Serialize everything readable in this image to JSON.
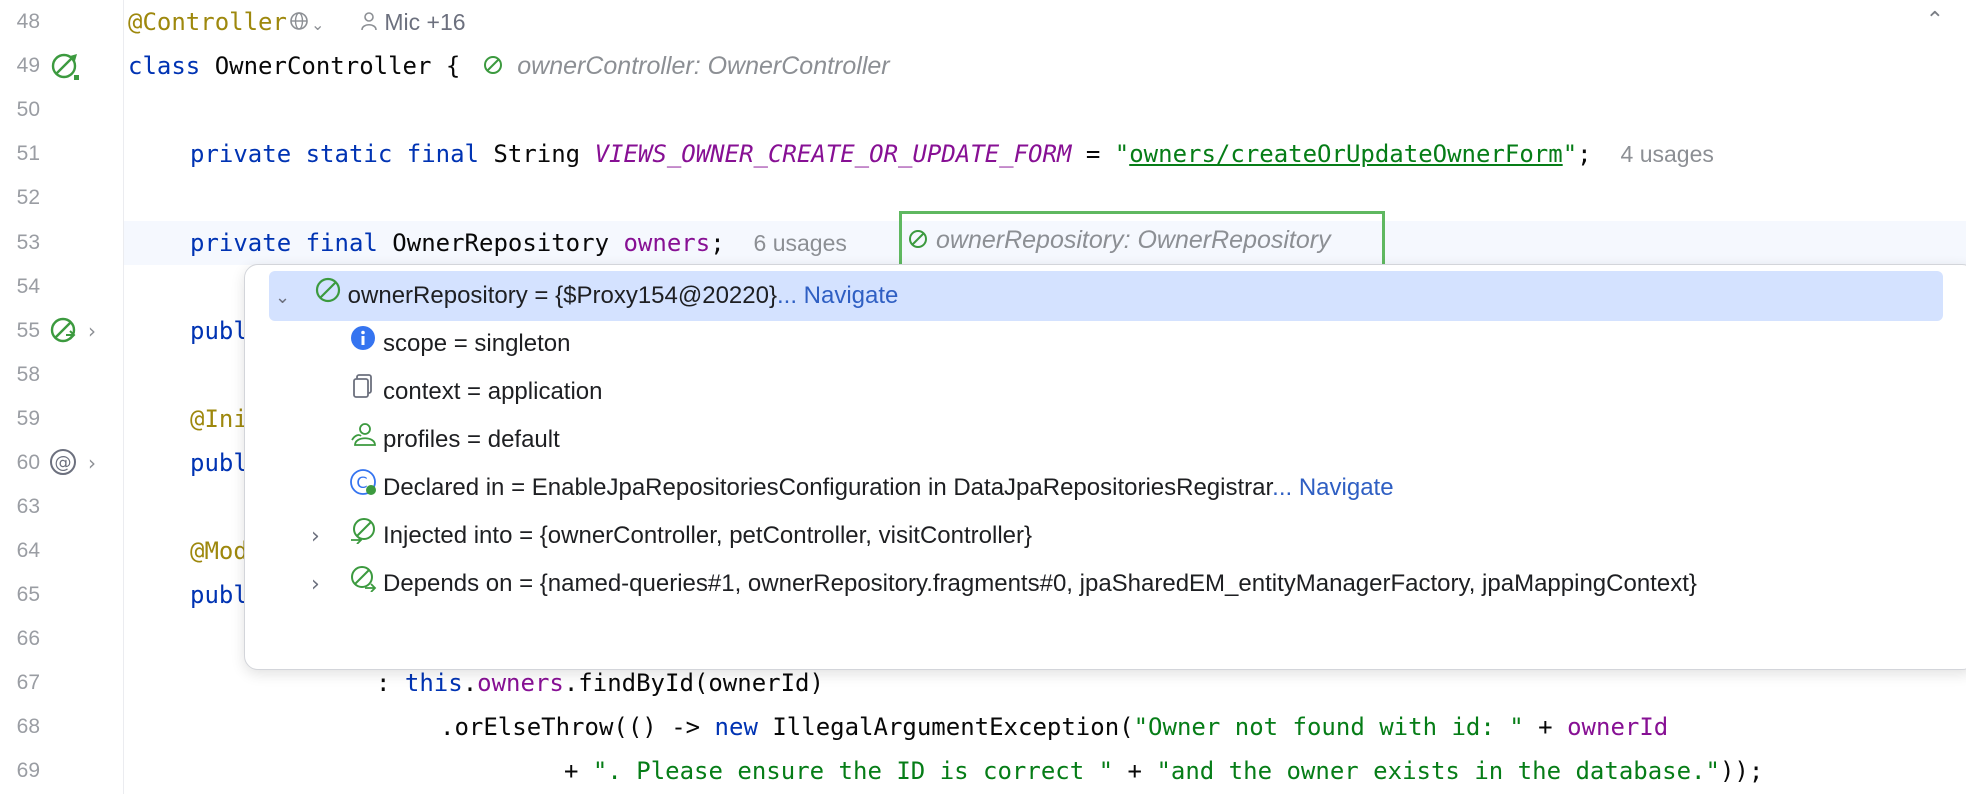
{
  "gutter": {
    "line_numbers": [
      "48",
      "49",
      "50",
      "51",
      "52",
      "53",
      "54",
      "55",
      "58",
      "59",
      "60",
      "63",
      "64",
      "65",
      "66",
      "67",
      "68",
      "69"
    ]
  },
  "code": {
    "l48_annotation": "@Controller",
    "l48_author": "Mic +16",
    "l49_kw": "class",
    "l49_name": " OwnerController {",
    "l49_hint": "ownerController: OwnerController",
    "l51_kw": "private static final",
    "l51_type": " String ",
    "l51_const": "VIEWS_OWNER_CREATE_OR_UPDATE_FORM",
    "l51_eq": " = ",
    "l51_q1": "\"",
    "l51_str": "owners/createOrUpdateOwnerForm",
    "l51_q2": "\"",
    "l51_semi": ";",
    "l51_usages": "4 usages",
    "l53_kw": "private final",
    "l53_type": " OwnerRepository ",
    "l53_field": "owners",
    "l53_semi": ";",
    "l53_usages": "6 usages",
    "l53_hint": "ownerRepository: OwnerRepository",
    "l55_kw": "publ",
    "l59_ann": "@Ini",
    "l60_kw": "publ",
    "l64_ann": "@Mod",
    "l65_kw": "publ",
    "l67_pre": ": ",
    "l67_this": "this",
    "l67_dot": ".",
    "l67_field": "owners",
    "l67_rest": ".findById(ownerId)",
    "l68_pre": ".orElseThrow(() -> ",
    "l68_new": "new",
    "l68_mid": " IllegalArgumentException(",
    "l68_str": "\"Owner not found with id: \"",
    "l68_plus": " + ",
    "l68_var": "ownerId",
    "l69_plus": "+ ",
    "l69_str1": "\". Please ensure the ID is correct \"",
    "l69_plus2": " + ",
    "l69_str2": "\"and the owner exists in the database.\"",
    "l69_end": "));"
  },
  "popup": {
    "root_label": "ownerRepository = {$Proxy154@20220}",
    "root_nav": "... Navigate",
    "scope": "scope = singleton",
    "context": "context = application",
    "profiles": "profiles = default",
    "declared": "Declared in = EnableJpaRepositoriesConfiguration in DataJpaRepositoriesRegistrar",
    "declared_nav": "... Navigate",
    "injected": "Injected into = {ownerController, petController, visitController}",
    "depends": "Depends on = {named-queries#1, ownerRepository.fragments#0, jpaSharedEM_entityManagerFactory, jpaMappingContext}"
  },
  "colors": {
    "keyword": "#0033b3",
    "annotation": "#9e880d",
    "field": "#871094",
    "string": "#067d17",
    "hint": "#8c8f94",
    "navigate_link": "#2f5fc3",
    "selection": "#d4e2ff",
    "bean_box": "#5fb860"
  },
  "icons": [
    "spring-bean-icon",
    "spring-bean-gutter-icon",
    "web-endpoint-icon",
    "author-icon",
    "info-icon",
    "context-icon",
    "profiles-icon",
    "declared-class-icon",
    "injected-icon",
    "depends-icon",
    "chevron-down-icon",
    "chevron-right-icon",
    "collapse-up-icon"
  ]
}
